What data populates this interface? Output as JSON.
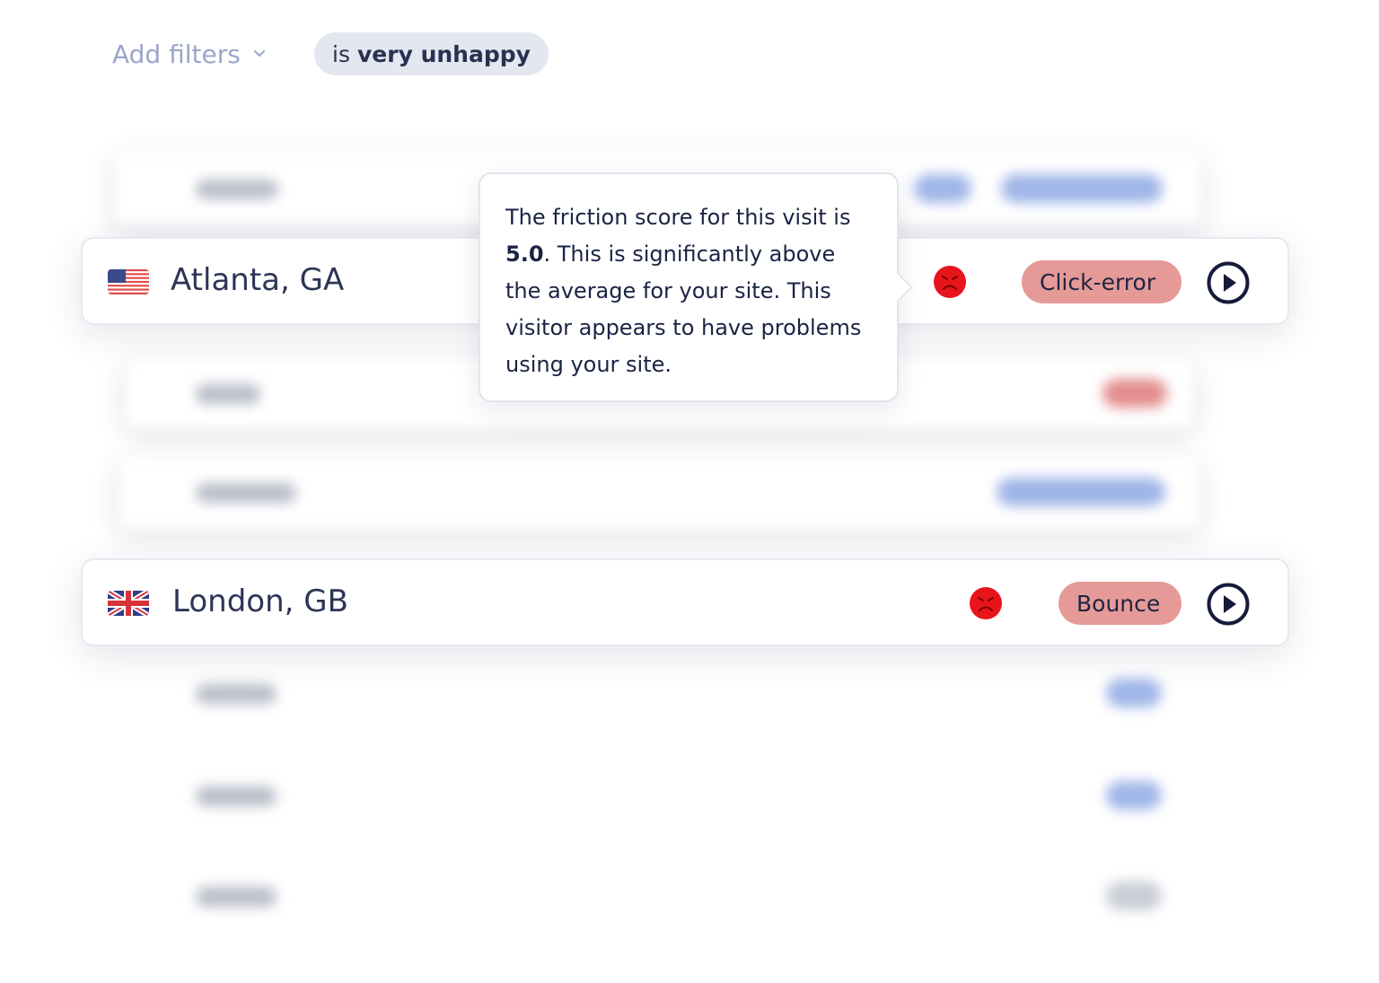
{
  "filters": {
    "add_label": "Add filters",
    "chip_prefix": "is",
    "chip_value": "very unhappy"
  },
  "rows": [
    {
      "city": "Atlanta, GA",
      "flag": "us-flag",
      "tag": "Click-error",
      "mood": "very-unhappy-face"
    },
    {
      "city": "London, GB",
      "flag": "gb-flag",
      "tag": "Bounce",
      "mood": "very-unhappy-face"
    }
  ],
  "tooltip": {
    "text_1": "The friction score for this visit is",
    "score": "5.0",
    "text_2": ". This is significantly above the average for your site. This visitor appears to have problems using your site."
  },
  "colors": {
    "tag_bg": "#e59a98",
    "face": "#e8141b",
    "filter_text": "#9aa6c9",
    "chip_bg": "#e3e7f0"
  }
}
